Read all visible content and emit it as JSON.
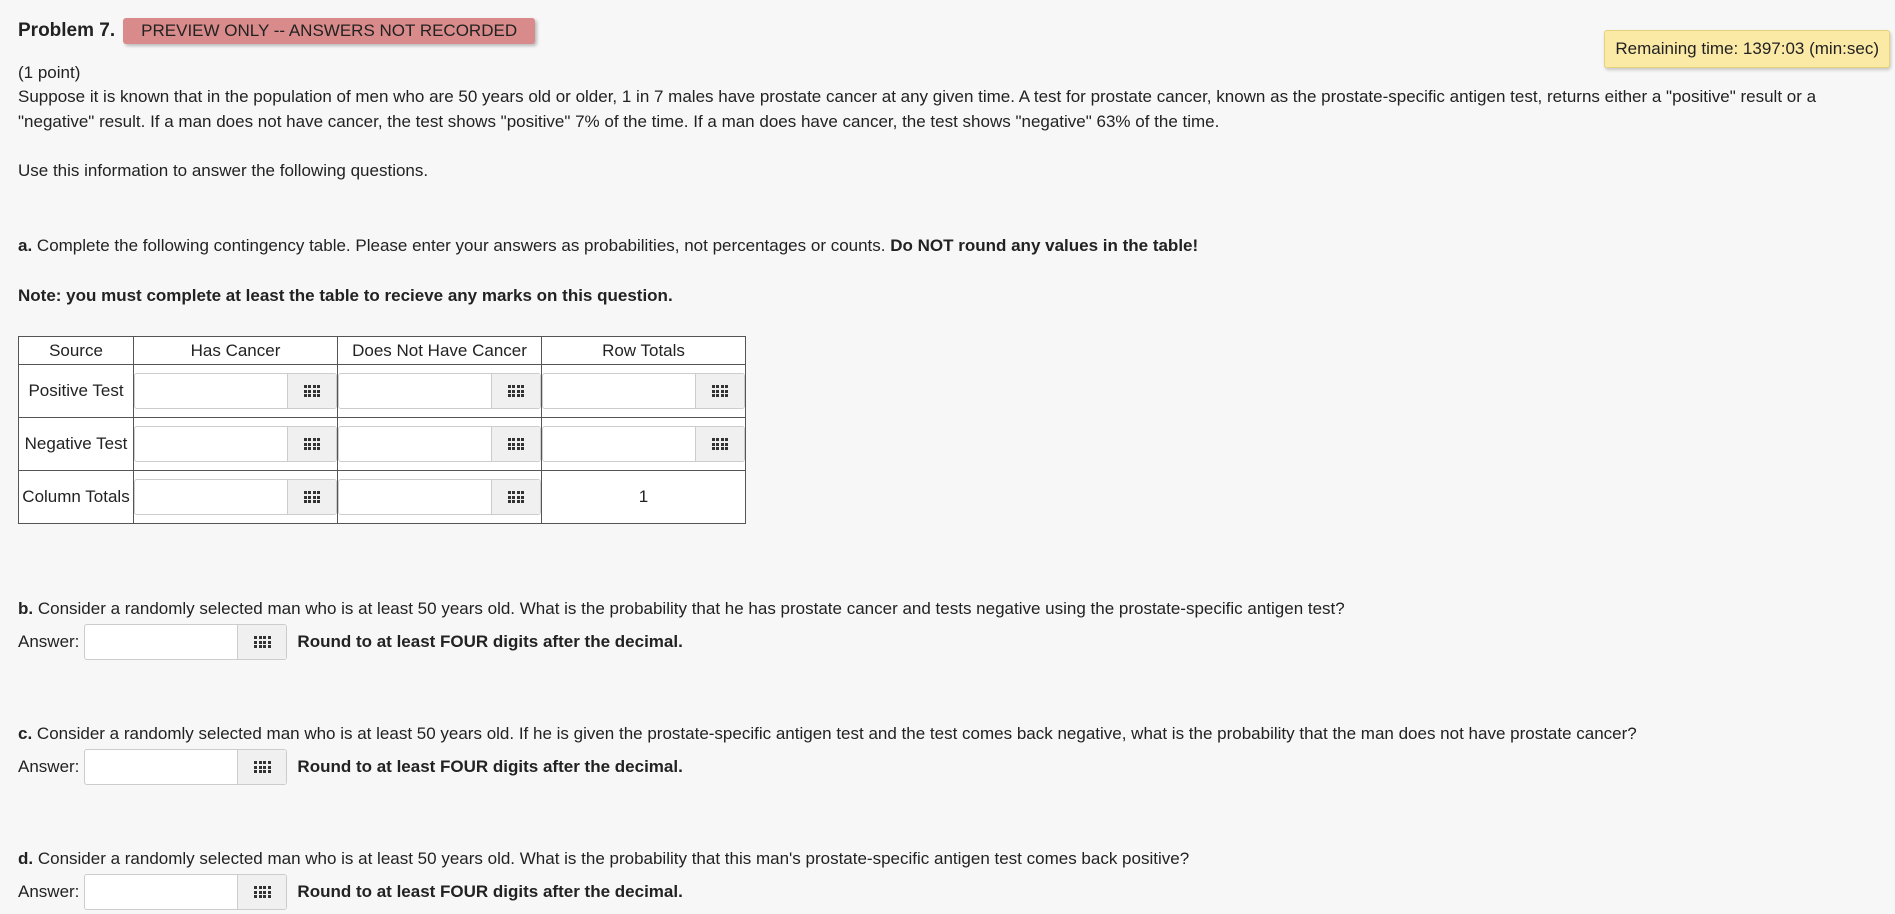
{
  "header": {
    "problem_label": "Problem 7.",
    "preview_badge": "PREVIEW ONLY -- ANSWERS NOT RECORDED",
    "timer": "Remaining time: 1397:03 (min:sec)"
  },
  "intro": {
    "points": "(1 point)",
    "text": "Suppose it is known that in the population of men who are 50 years old or older, 1 in 7 males have prostate cancer at any given time. A test for prostate cancer, known as the prostate-specific antigen test, returns either a \"positive\" result or a \"negative\" result. If a man does not have cancer, the test shows \"positive\" 7% of the time. If a man does have cancer, the test shows \"negative\" 63% of the time.",
    "instruction": "Use this information to answer the following questions."
  },
  "part_a": {
    "letter": "a.",
    "text": " Complete the following contingency table. Please enter your answers as probabilities, not percentages or counts. ",
    "bold": "Do NOT round any values in the table!",
    "note": "Note: you must complete at least the table to recieve any marks on this question."
  },
  "table": {
    "headers": [
      "Source",
      "Has Cancer",
      "Does Not Have Cancer",
      "Row Totals"
    ],
    "rows": [
      {
        "label": "Positive Test"
      },
      {
        "label": "Negative Test"
      },
      {
        "label": "Column Totals",
        "total": "1"
      }
    ]
  },
  "part_b": {
    "letter": "b.",
    "text": " Consider a randomly selected man who is at least 50 years old. What is the probability that he has prostate cancer and tests negative using the prostate-specific antigen test?",
    "answer_label": "Answer:",
    "note": "Round to at least FOUR digits after the decimal."
  },
  "part_c": {
    "letter": "c.",
    "text": " Consider a randomly selected man who is at least 50 years old. If he is given the prostate-specific antigen test and the test comes back negative, what is the probability that the man does not have prostate cancer?",
    "answer_label": "Answer:",
    "note": "Round to at least FOUR digits after the decimal."
  },
  "part_d": {
    "letter": "d.",
    "text": " Consider a randomly selected man who is at least 50 years old. What is the probability that this man's prostate-specific antigen test comes back positive?",
    "answer_label": "Answer:",
    "note": "Round to at least FOUR digits after the decimal."
  },
  "icons": {
    "keypad": "keypad-grid-icon"
  },
  "colors": {
    "badge": "#d98a8a",
    "timer": "#fbe9a6",
    "background": "#f7f7f7"
  }
}
